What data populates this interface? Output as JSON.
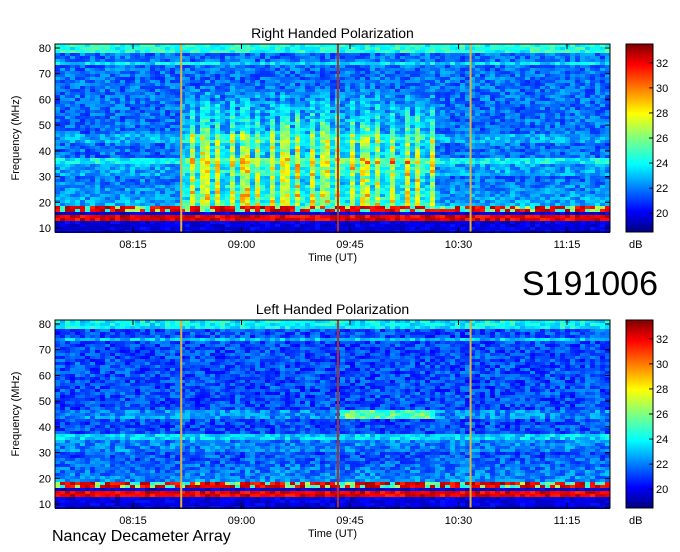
{
  "event_id": "S191006",
  "footer": "Nancay Decameter Array",
  "chart_data": [
    {
      "type": "heatmap",
      "title": "Right Handed Polarization",
      "xlabel": "Time (UT)",
      "ylabel": "Frequency (MHz)",
      "x_ticks": [
        "08:15",
        "09:00",
        "09:45",
        "10:30",
        "11:15"
      ],
      "y_ticks": [
        10,
        20,
        30,
        40,
        50,
        60,
        70,
        80
      ],
      "ylim": [
        10,
        80
      ],
      "colorbar": {
        "label": "dB",
        "ticks": [
          20,
          22,
          24,
          26,
          28,
          30,
          32
        ],
        "range": [
          18.5,
          33.5
        ]
      },
      "features": {
        "background_db": 22,
        "low_band_interference": "strong emission below 18 MHz",
        "vertical_lines_time": [
          "08:35",
          "09:40",
          "10:35"
        ],
        "burst_activity": {
          "start": "08:35",
          "end": "10:20",
          "freq_range_mhz": [
            18,
            65
          ],
          "peak_db": 28
        }
      }
    },
    {
      "type": "heatmap",
      "title": "Left Handed Polarization",
      "xlabel": "Time (UT)",
      "ylabel": "Frequency (MHz)",
      "x_ticks": [
        "08:15",
        "09:00",
        "09:45",
        "10:30",
        "11:15"
      ],
      "y_ticks": [
        10,
        20,
        30,
        40,
        50,
        60,
        70,
        80
      ],
      "ylim": [
        10,
        80
      ],
      "colorbar": {
        "label": "dB",
        "ticks": [
          20,
          22,
          24,
          26,
          28,
          30,
          32
        ],
        "range": [
          18.5,
          33.5
        ]
      },
      "features": {
        "background_db": 21.5,
        "low_band_interference": "strong emission below 18 MHz",
        "vertical_lines_time": [
          "08:35",
          "09:40",
          "10:35"
        ],
        "burst_activity": {
          "start": "09:40",
          "end": "10:20",
          "freq_range_mhz": [
            43,
            46
          ],
          "peak_db": 25
        }
      }
    }
  ]
}
